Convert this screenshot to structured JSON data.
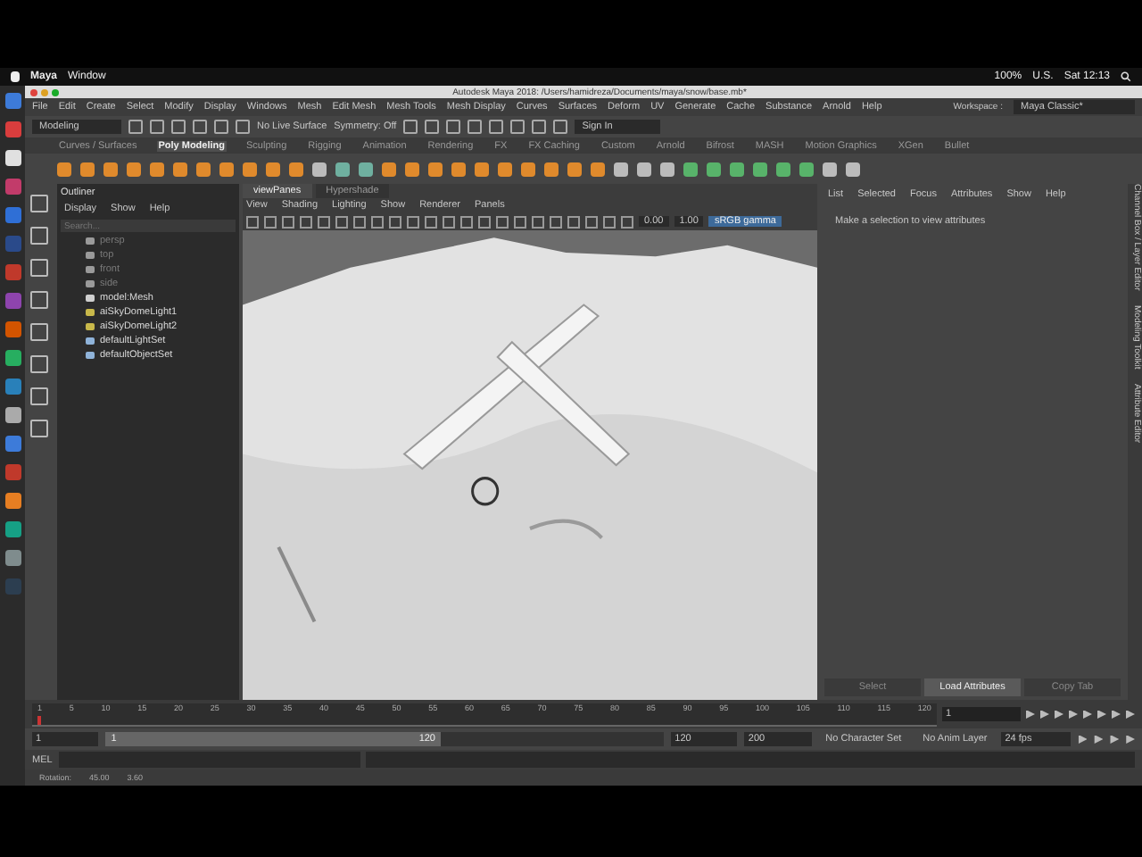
{
  "mac_menu_bar": {
    "app": "Maya",
    "menus": [
      "Window"
    ],
    "battery": "100%",
    "input_source": "U.S.",
    "clock": "Sat 12:13"
  },
  "window": {
    "title": "Autodesk Maya 2018: /Users/hamidreza/Documents/maya/snow/base.mb*"
  },
  "menu_bar": [
    "File",
    "Edit",
    "Create",
    "Select",
    "Modify",
    "Display",
    "Windows",
    "Mesh",
    "Edit Mesh",
    "Mesh Tools",
    "Mesh Display",
    "Curves",
    "Surfaces",
    "Deform",
    "UV",
    "Generate",
    "Cache",
    "Substance",
    "Arnold",
    "Help"
  ],
  "workspace": {
    "label": "Workspace :",
    "value": "Maya Classic*"
  },
  "status_line": {
    "mode": "Modeling",
    "live_surface": "No Live Surface",
    "symmetry": "Symmetry: Off",
    "sign_in": "Sign In"
  },
  "shelf_tabs": [
    {
      "label": "Curves / Surfaces",
      "selected": false
    },
    {
      "label": "Poly Modeling",
      "selected": true
    },
    {
      "label": "Sculpting",
      "selected": false
    },
    {
      "label": "Rigging",
      "selected": false
    },
    {
      "label": "Animation",
      "selected": false
    },
    {
      "label": "Rendering",
      "selected": false
    },
    {
      "label": "FX",
      "selected": false
    },
    {
      "label": "FX Caching",
      "selected": false
    },
    {
      "label": "Custom",
      "selected": false
    },
    {
      "label": "Arnold",
      "selected": false
    },
    {
      "label": "Bifrost",
      "selected": false
    },
    {
      "label": "MASH",
      "selected": false
    },
    {
      "label": "Motion Graphics",
      "selected": false
    },
    {
      "label": "XGen",
      "selected": false
    },
    {
      "label": "Bullet",
      "selected": false
    }
  ],
  "outliner": {
    "title": "Outliner",
    "menus": [
      "Display",
      "Show",
      "Help"
    ],
    "search_placeholder": "Search...",
    "items": [
      {
        "label": "persp",
        "kind": "camera",
        "dimmed": true
      },
      {
        "label": "top",
        "kind": "camera",
        "dimmed": true
      },
      {
        "label": "front",
        "kind": "camera",
        "dimmed": true
      },
      {
        "label": "side",
        "kind": "camera",
        "dimmed": true
      },
      {
        "label": "model:Mesh",
        "kind": "mesh",
        "dimmed": false
      },
      {
        "label": "aiSkyDomeLight1",
        "kind": "light",
        "dimmed": false
      },
      {
        "label": "aiSkyDomeLight2",
        "kind": "light",
        "dimmed": false
      },
      {
        "label": "defaultLightSet",
        "kind": "set",
        "dimmed": false
      },
      {
        "label": "defaultObjectSet",
        "kind": "set",
        "dimmed": false
      }
    ]
  },
  "viewport": {
    "tabs": [
      {
        "label": "viewPanes",
        "selected": true
      },
      {
        "label": "Hypershade",
        "selected": false
      }
    ],
    "menus": [
      "View",
      "Shading",
      "Lighting",
      "Show",
      "Renderer",
      "Panels"
    ],
    "exposure": "0.00",
    "gamma": "1.00",
    "color_space": "sRGB gamma"
  },
  "attribute_editor": {
    "menus": [
      "List",
      "Selected",
      "Focus",
      "Attributes",
      "Show",
      "Help"
    ],
    "message": "Make a selection to view attributes",
    "buttons": [
      {
        "label": "Select",
        "selected": false
      },
      {
        "label": "Load Attributes",
        "selected": true
      },
      {
        "label": "Copy Tab",
        "selected": false
      }
    ]
  },
  "side_tabs": [
    "Channel Box / Layer Editor",
    "Modeling Toolkit",
    "Attribute Editor"
  ],
  "time_slider": {
    "ticks": [
      "1",
      "5",
      "10",
      "15",
      "20",
      "25",
      "30",
      "35",
      "40",
      "45",
      "50",
      "55",
      "60",
      "65",
      "70",
      "75",
      "80",
      "85",
      "90",
      "95",
      "100",
      "105",
      "110",
      "115",
      "120"
    ],
    "current_frame": "1",
    "level": 0
  },
  "range_slider": {
    "start": "1",
    "range_start": "1",
    "range_end": "120",
    "end": "120",
    "max": "200",
    "character_set": "No Character Set",
    "anim_layer": "No Anim Layer",
    "fps": "24 fps",
    "level": 0.6
  },
  "command_line": {
    "label": "MEL"
  },
  "help_line": [
    "Rotation:",
    "45.00",
    "3.60"
  ]
}
